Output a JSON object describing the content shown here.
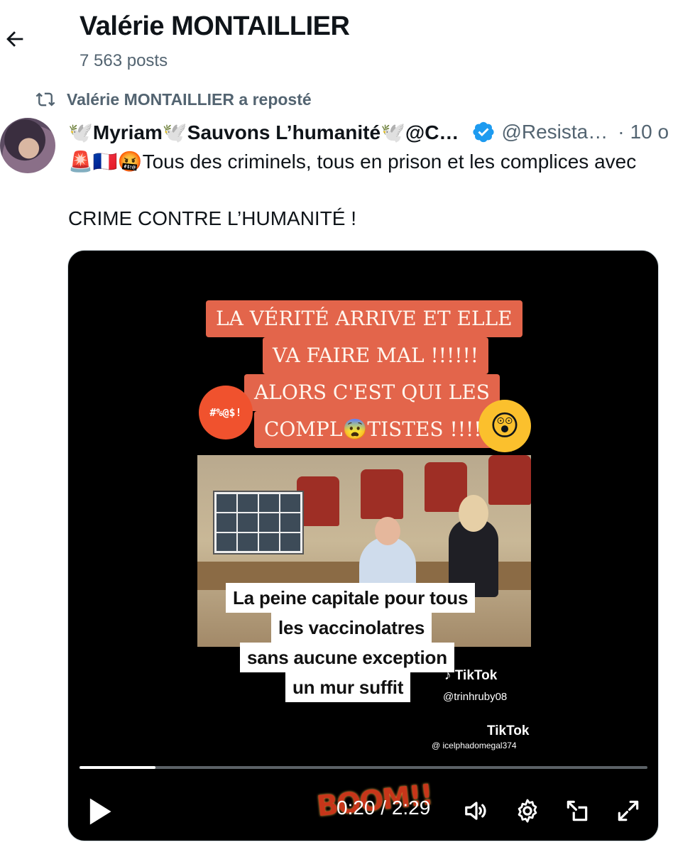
{
  "header": {
    "title": "Valérie MONTAILLIER",
    "post_count": "7 563 posts"
  },
  "repost": {
    "text": "Valérie MONTAILLIER a reposté"
  },
  "post": {
    "author_name": "🕊️Myriam🕊️Sauvons L’humanité🕊️@C…",
    "author_handle": "@Resista…",
    "time": "10 o",
    "line1": "🚨🇫🇷🤬Tous des criminels, tous en prison et les complices avec",
    "line2": "CRIME CONTRE L’HUMANITÉ !"
  },
  "video": {
    "sign_lines": [
      "LA VÉRITÉ ARRIVE ET ELLE",
      "VA FAIRE MAL !!!!!!",
      "ALORS C'EST QUI LES",
      "COMPL😨TISTES !!!!!!!"
    ],
    "angry_emoji_text": "#%@$!",
    "shocked_emoji": "😲",
    "captions": [
      "La peine capitale pour tous",
      "les vaccinolatres",
      "sans aucune exception",
      "un mur suffit"
    ],
    "tiktok_label": "TikTok",
    "tiktok_handle_1": "@trinhruby08",
    "tiktok_handle_2": "@ icelphadomegal374",
    "overlay_word": "BOOM!!",
    "time_display": "0:20 / 2:29",
    "progress": 0.134
  },
  "colors": {
    "secondary_text": "#536471",
    "verified_blue": "#1d9bf0",
    "sign_orange": "#e3654b"
  },
  "icons": {
    "back": "arrow-left-icon",
    "repost": "repost-icon",
    "verified": "verified-badge-icon",
    "play": "play-icon",
    "volume": "volume-icon",
    "settings": "gear-icon",
    "pip": "picture-in-picture-icon",
    "fullscreen": "fullscreen-icon"
  }
}
